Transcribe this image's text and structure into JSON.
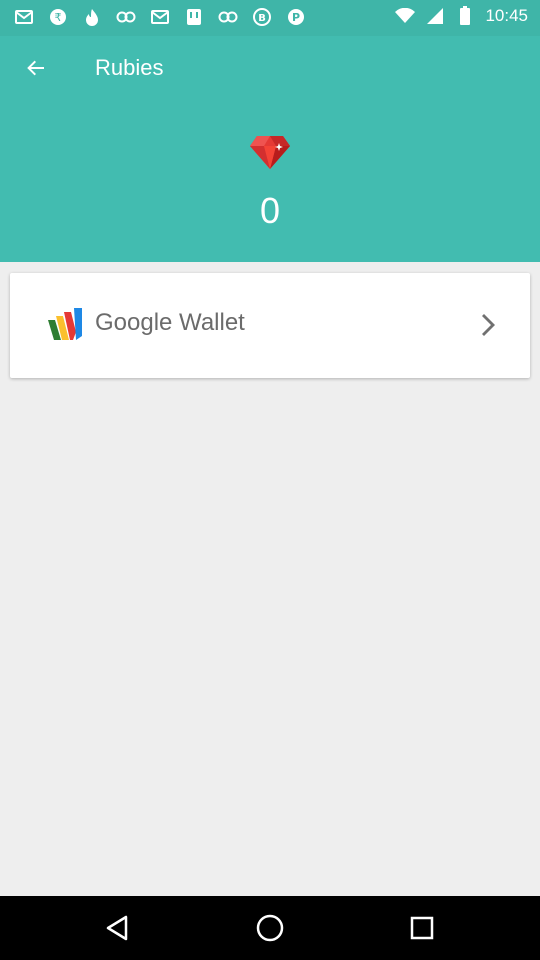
{
  "status_bar": {
    "time": "10:45",
    "left_icons": [
      "mail-icon",
      "rupee-icon",
      "tinder-icon",
      "link-icon",
      "mail-icon",
      "bank-icon",
      "link-icon",
      "b-icon",
      "pinterest-icon"
    ],
    "right_icons": [
      "wifi-icon",
      "signal-icon",
      "battery-icon"
    ]
  },
  "app_bar": {
    "title": "Rubies",
    "back_icon": "arrow-left-icon"
  },
  "balance": {
    "icon": "ruby-icon",
    "value": "0"
  },
  "payment_option": {
    "logo": "google-wallet-icon",
    "label": "Google Wallet",
    "chevron": "chevron-right-icon"
  },
  "colors": {
    "primary": "#42bcb0",
    "status_bar": "#3fb5a8",
    "background": "#eeeeee",
    "ruby": "#e53935"
  },
  "nav_bar": {
    "buttons": [
      "back-triangle-icon",
      "home-circle-icon",
      "recents-square-icon"
    ]
  }
}
